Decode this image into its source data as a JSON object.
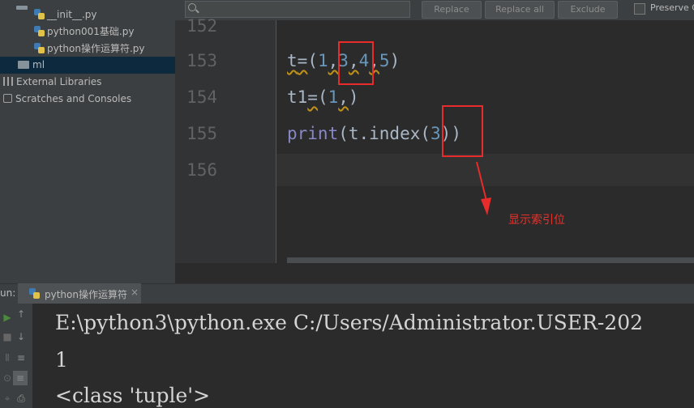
{
  "project_tree": {
    "items": [
      {
        "label": "__init__.py"
      },
      {
        "label": "python001基础.py"
      },
      {
        "label": "python操作运算符.py"
      },
      {
        "label": "ml"
      },
      {
        "label": "External Libraries"
      },
      {
        "label": "Scratches and Consoles"
      }
    ]
  },
  "find_bar": {
    "search_icon": "search-icon",
    "buttons": [
      "Replace",
      "Replace all",
      "Exclude"
    ],
    "preserve_case_label": "Preserve C"
  },
  "editor": {
    "line_numbers": [
      "152",
      "153",
      "154",
      "155",
      "156"
    ],
    "lines": {
      "l153": {
        "a": "t",
        "b": "=",
        "c": "(",
        "n1": "1",
        "s1": ",",
        "n2": "3",
        "s2": ",",
        "n3": "4",
        "s3": ",",
        "n4": "5",
        "e": ")"
      },
      "l154": {
        "a": "t1",
        "b": "=",
        "c": "(",
        "n1": "1",
        "s1": ",",
        "e": ")"
      },
      "l155": {
        "fn": "print",
        "c": "(t.index(",
        "n": "3",
        "e": "))"
      }
    },
    "annotation": "显示索引位",
    "colors": {
      "annotation": "#e8312b",
      "box": "#e82b2b"
    }
  },
  "run_panel": {
    "prefix": "un:",
    "tab_label": "python操作运算符",
    "close_glyph": "×",
    "console_lines": [
      "E:\\python3\\python.exe C:/Users/Administrator.USER-202",
      "1",
      "<class 'tuple'>"
    ]
  }
}
